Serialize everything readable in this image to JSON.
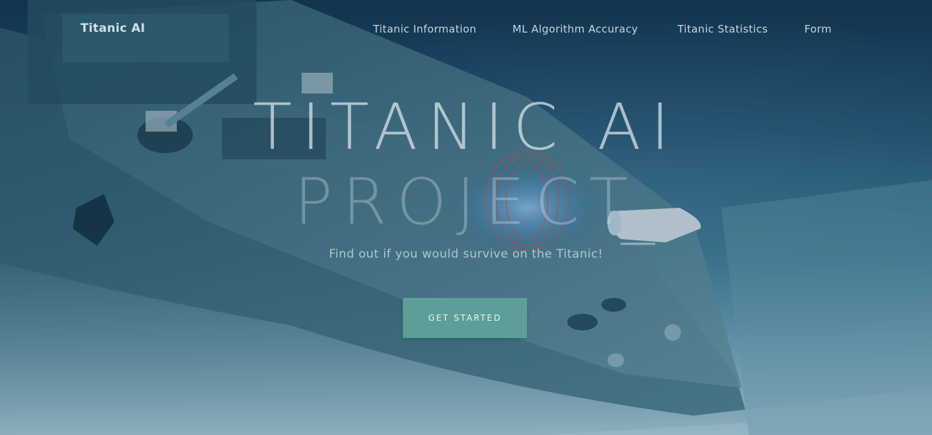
{
  "navbar": {
    "brand": "Titanic AI",
    "links": [
      {
        "label": "Titanic Information"
      },
      {
        "label": "ML Algorithm Accuracy"
      },
      {
        "label": "Titanic Statistics"
      },
      {
        "label": "Form"
      }
    ]
  },
  "hero": {
    "title_line1": "TITANIC AI",
    "title_line2": "PROJECT",
    "subtitle": "Find out if you would survive on the Titanic!",
    "cta_label": "GET STARTED"
  },
  "colors": {
    "cta_background": "#5f9e98",
    "nav_text": "#c8d6e0",
    "water_deep": "#0e2b45",
    "seabed": "#b7d8e0"
  }
}
